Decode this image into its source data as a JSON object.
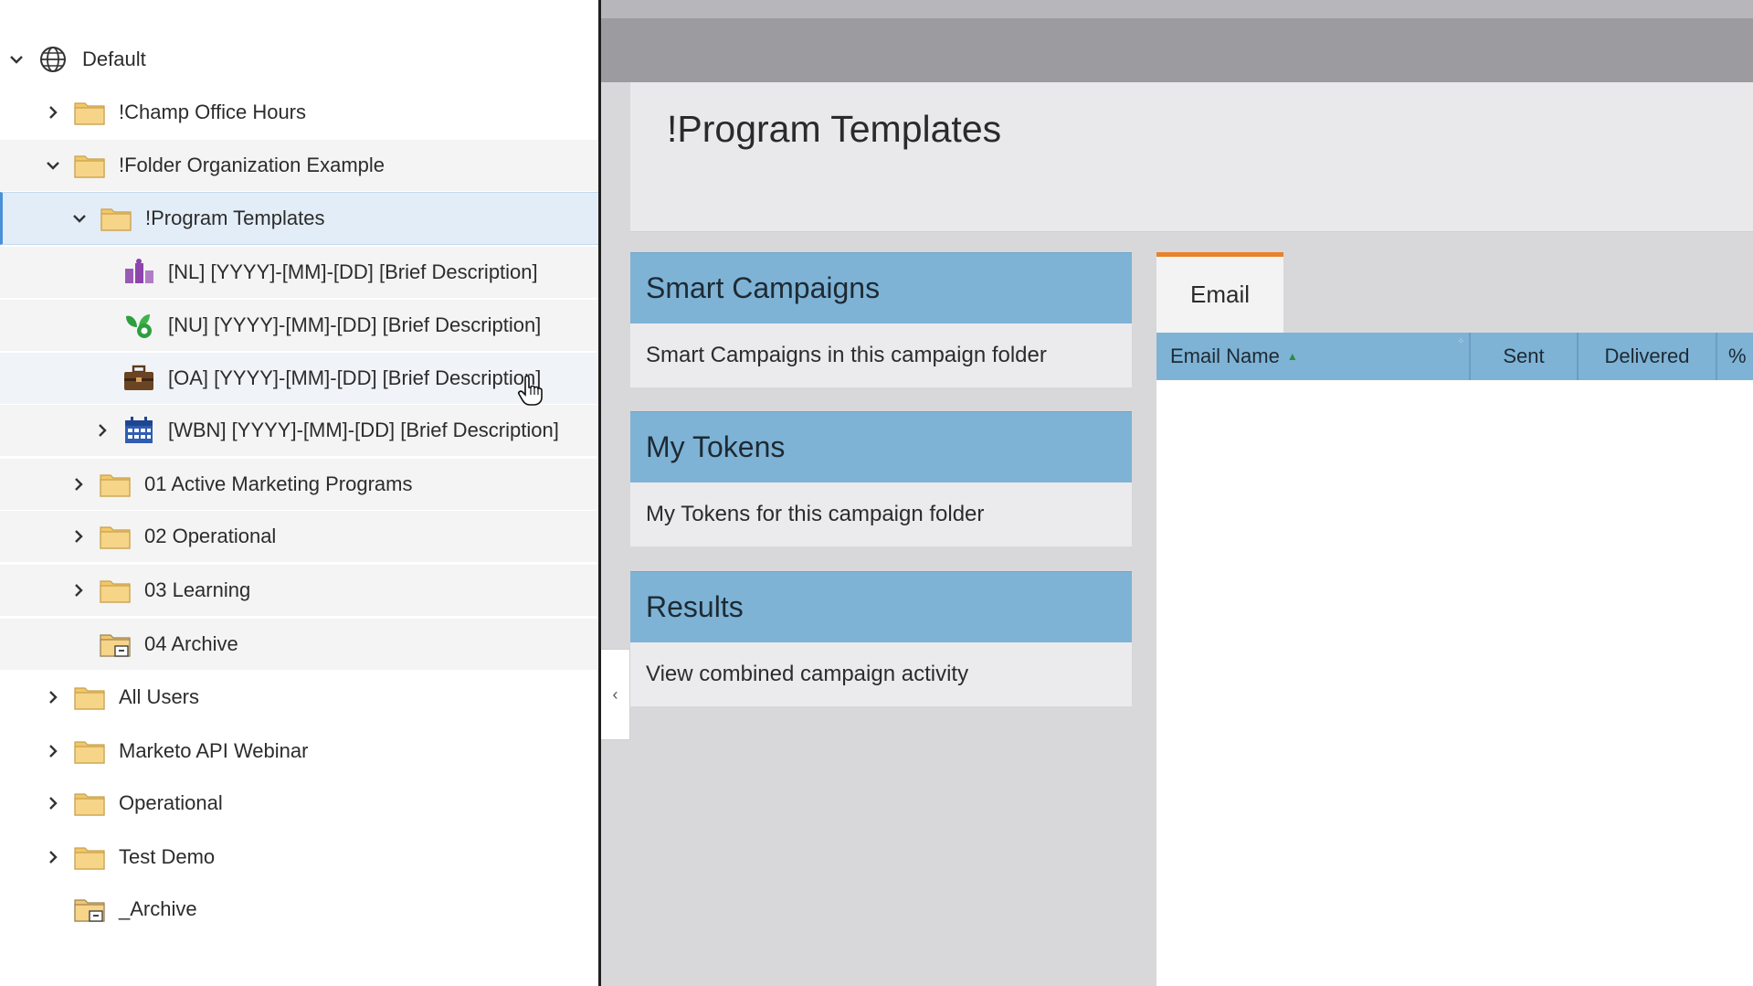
{
  "tree": {
    "items": [
      {
        "label": "Default",
        "icon": "globe-icon",
        "expanded": true
      },
      {
        "label": "!Champ Office Hours",
        "icon": "folder-icon",
        "expanded": false
      },
      {
        "label": "!Folder Organization Example",
        "icon": "folder-icon",
        "expanded": true
      },
      {
        "label": "!Program Templates",
        "icon": "folder-icon",
        "expanded": true,
        "selected": true
      },
      {
        "label": "[NL] [YYYY]-[MM]-[DD] [Brief Description]",
        "icon": "event-program-icon"
      },
      {
        "label": "[NU] [YYYY]-[MM]-[DD] [Brief Description]",
        "icon": "engagement-program-icon"
      },
      {
        "label": "[OA] [YYYY]-[MM]-[DD] [Brief Description]",
        "icon": "default-program-icon"
      },
      {
        "label": "[WBN] [YYYY]-[MM]-[DD] [Brief Description]",
        "icon": "webinar-calendar-icon",
        "expanded": false
      },
      {
        "label": "01 Active Marketing Programs",
        "icon": "folder-icon",
        "expanded": false
      },
      {
        "label": "02 Operational",
        "icon": "folder-icon",
        "expanded": false
      },
      {
        "label": "03 Learning",
        "icon": "folder-icon",
        "expanded": false
      },
      {
        "label": "04 Archive",
        "icon": "archive-folder-icon"
      },
      {
        "label": "All Users",
        "icon": "folder-icon",
        "expanded": false
      },
      {
        "label": "Marketo API Webinar",
        "icon": "folder-icon",
        "expanded": false
      },
      {
        "label": "Operational",
        "icon": "folder-icon",
        "expanded": false
      },
      {
        "label": "Test Demo",
        "icon": "folder-icon",
        "expanded": false
      },
      {
        "label": "_Archive",
        "icon": "archive-folder-icon"
      }
    ]
  },
  "main": {
    "title": "!Program Templates",
    "cards": [
      {
        "title": "Smart Campaigns",
        "description": "Smart Campaigns in this campaign folder"
      },
      {
        "title": "My Tokens",
        "description": "My Tokens for this campaign folder"
      },
      {
        "title": "Results",
        "description": "View combined campaign activity"
      }
    ],
    "collapse_glyph": "‹",
    "email_panel": {
      "tab_label": "Email",
      "columns": {
        "name": "Email Name",
        "sent": "Sent",
        "delivered": "Delivered",
        "pct": "%"
      },
      "sort_glyph": "▲"
    }
  },
  "colors": {
    "card_header": "#7eb3d6",
    "tab_accent": "#e8822b",
    "folder": "#f2c76b",
    "selection": "#e3edf7"
  }
}
